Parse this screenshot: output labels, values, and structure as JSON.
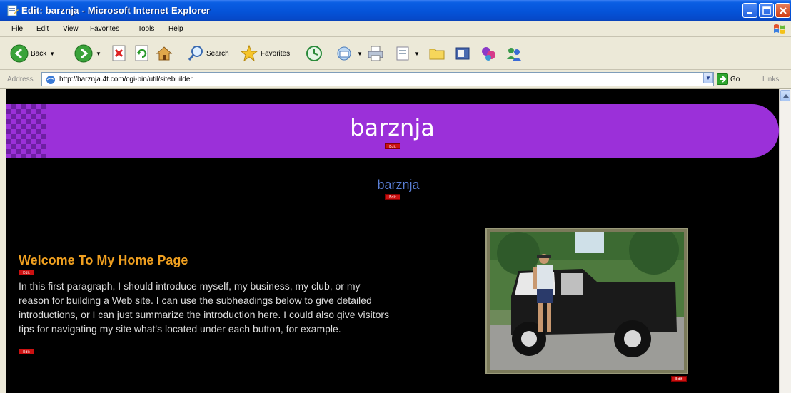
{
  "window": {
    "title": "Edit: barznja - Microsoft Internet Explorer"
  },
  "menu": [
    "File",
    "Edit",
    "View",
    "Favorites",
    "Tools",
    "Help"
  ],
  "toolbar": {
    "back_label": "Back",
    "search_label": "Search",
    "favorites_label": "Favorites"
  },
  "address": {
    "label": "Address",
    "url": "http://barznja.4t.com/cgi-bin/util/sitebuilder",
    "go_label": "Go",
    "links_label": "Links"
  },
  "page": {
    "site_title": "barznja",
    "nav_link": "barznja",
    "edit_label": "Edit",
    "heading": "Welcome To My Home Page",
    "intro": "In this first paragraph, I should introduce myself, my business, my club, or my reason for building a Web site. I can use the subheadings below to give detailed introductions, or I can just summarize the introduction here. I could also give visitors tips for navigating my site what's located under each button, for example.",
    "colors": {
      "banner": "#9b30d9",
      "heading": "#f0a020",
      "link": "#5a7fd6",
      "background": "#000000",
      "edit_tag": "#cc1111"
    }
  }
}
